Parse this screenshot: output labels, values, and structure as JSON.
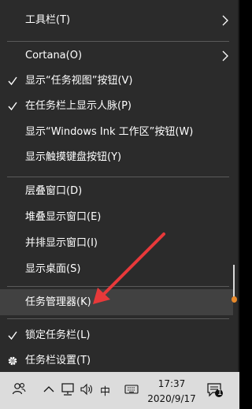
{
  "context_menu": {
    "items": [
      {
        "label": "工具栏(T)",
        "checked": false,
        "submenu": true
      },
      {
        "label": "Cortana(O)",
        "checked": false,
        "submenu": true
      },
      {
        "label": "显示“任务视图”按钮(V)",
        "checked": true,
        "submenu": false
      },
      {
        "label": "在任务栏上显示人脉(P)",
        "checked": true,
        "submenu": false
      },
      {
        "label": "显示“Windows Ink 工作区”按钮(W)",
        "checked": false,
        "submenu": false
      },
      {
        "label": "显示触摸键盘按钮(Y)",
        "checked": false,
        "submenu": false
      },
      {
        "label": "层叠窗口(D)",
        "checked": false,
        "submenu": false
      },
      {
        "label": "堆叠显示窗口(E)",
        "checked": false,
        "submenu": false
      },
      {
        "label": "并排显示窗口(I)",
        "checked": false,
        "submenu": false
      },
      {
        "label": "显示桌面(S)",
        "checked": false,
        "submenu": false
      },
      {
        "label": "任务管理器(K)",
        "checked": false,
        "submenu": false,
        "highlighted": true
      },
      {
        "label": "锁定任务栏(L)",
        "checked": true,
        "submenu": false
      },
      {
        "label": "任务栏设置(T)",
        "checked": false,
        "submenu": false,
        "icon": "gear-icon"
      }
    ]
  },
  "taskbar": {
    "ime_label": "中",
    "time": "17:37",
    "date": "2020/9/17",
    "notification_count": "1",
    "icons": [
      "people-icon",
      "chevron-up-icon",
      "network-icon",
      "volume-icon",
      "notification-icon"
    ]
  },
  "colors": {
    "menu_bg": "#2b2b2b",
    "highlight_bg": "#414141",
    "annotation_arrow": "#e8393a",
    "taskbar_bg": "#dcdcdc"
  }
}
